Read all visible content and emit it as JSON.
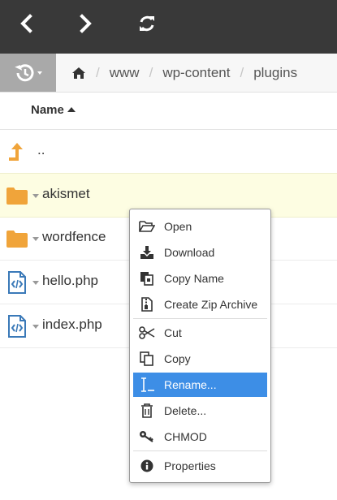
{
  "toolbar": {
    "back_icon": "chevron-left-icon",
    "forward_icon": "chevron-right-icon",
    "refresh_icon": "refresh-icon"
  },
  "breadcrumb": {
    "history_icon": "history-icon",
    "home_icon": "home-icon",
    "items": [
      "www",
      "wp-content",
      "plugins"
    ]
  },
  "columns": {
    "name_label": "Name",
    "sort": "ascending"
  },
  "files": [
    {
      "name": "..",
      "type": "parent"
    },
    {
      "name": "akismet",
      "type": "folder",
      "selected": true
    },
    {
      "name": "wordfence",
      "type": "folder"
    },
    {
      "name": "hello.php",
      "type": "code"
    },
    {
      "name": "index.php",
      "type": "code"
    }
  ],
  "context_menu": {
    "items": [
      {
        "label": "Open",
        "icon": "folder-open-icon"
      },
      {
        "label": "Download",
        "icon": "download-icon"
      },
      {
        "label": "Copy Name",
        "icon": "copy-name-icon"
      },
      {
        "label": "Create Zip Archive",
        "icon": "zip-icon"
      },
      {
        "label": "Cut",
        "icon": "scissors-icon"
      },
      {
        "label": "Copy",
        "icon": "copy-icon"
      },
      {
        "label": "Rename...",
        "icon": "text-cursor-icon",
        "active": true
      },
      {
        "label": "Delete...",
        "icon": "trash-icon"
      },
      {
        "label": "CHMOD",
        "icon": "key-icon"
      },
      {
        "label": "Properties",
        "icon": "info-icon"
      }
    ]
  },
  "colors": {
    "topbar": "#393939",
    "selected_row": "#fdfde2",
    "menu_highlight": "#3d8ee6",
    "folder": "#f0a43a",
    "code_icon": "#3a79b8"
  }
}
